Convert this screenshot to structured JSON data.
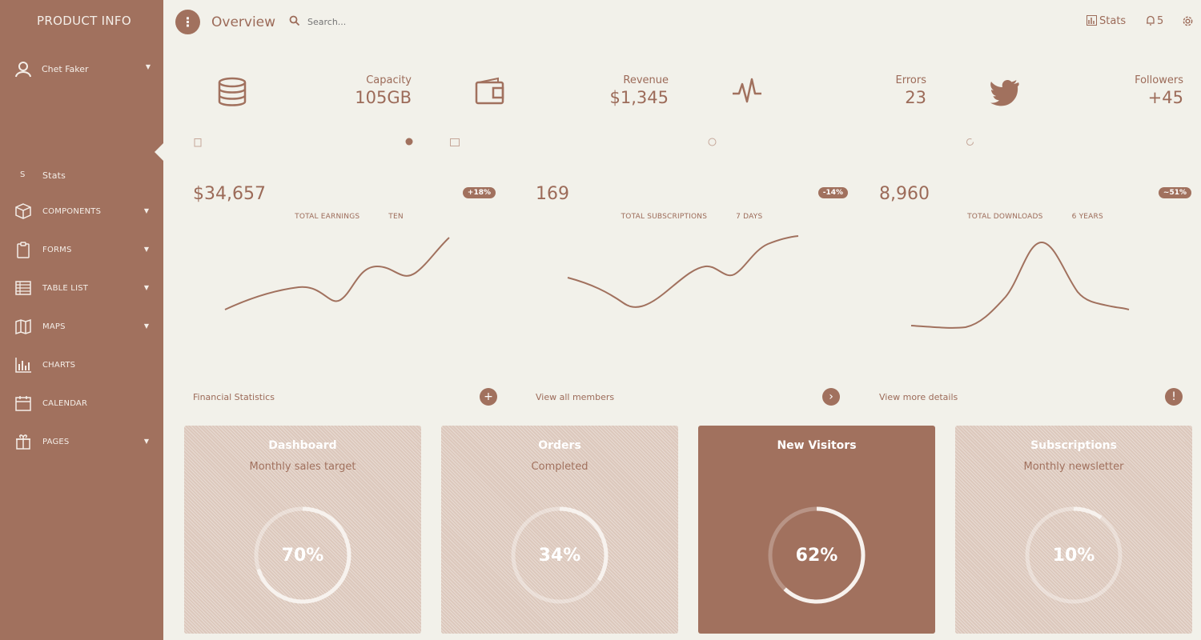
{
  "sidebar": {
    "brand": "PRODUCT INFO",
    "user_name": "Chet Faker",
    "stats_letter": "S",
    "stats_label": "Stats",
    "items": [
      {
        "label": "COMPONENTS",
        "icon": "cube-icon"
      },
      {
        "label": "FORMS",
        "icon": "clipboard-icon"
      },
      {
        "label": "TABLE LIST",
        "icon": "table-list-icon"
      },
      {
        "label": "MAPS",
        "icon": "map-icon"
      },
      {
        "label": "CHARTS",
        "icon": "chart-icon"
      },
      {
        "label": "CALENDAR",
        "icon": "calendar-icon"
      },
      {
        "label": "PAGES",
        "icon": "gift-icon"
      }
    ]
  },
  "topbar": {
    "title": "Overview",
    "search_placeholder": "Search...",
    "stats_label": "Stats",
    "notifications_count": "5"
  },
  "kpis": [
    {
      "label": "Capacity",
      "value": "105GB",
      "icon": "database-icon"
    },
    {
      "label": "Revenue",
      "value": "$1,345",
      "icon": "wallet-icon"
    },
    {
      "label": "Errors",
      "value": "23",
      "icon": "pulse-icon"
    },
    {
      "label": "Followers",
      "value": "+45",
      "icon": "twitter-icon"
    }
  ],
  "charts": [
    {
      "value": "$34,657",
      "badge": "+18%",
      "caption": "TOTAL EARNINGS",
      "period": "TEN"
    },
    {
      "value": "169",
      "badge": "-14%",
      "caption": "TOTAL SUBSCRIPTIONS",
      "period": "7 DAYS"
    },
    {
      "value": "8,960",
      "badge": "~51%",
      "caption": "TOTAL DOWNLOADS",
      "period": "6 YEARS"
    }
  ],
  "footer_links": {
    "financial": "Financial Statistics",
    "members": "View all members",
    "details": "View more details"
  },
  "tiles": [
    {
      "title": "Dashboard",
      "subtitle": "Monthly sales target",
      "percent": "70%",
      "fraction": 0.7
    },
    {
      "title": "Orders",
      "subtitle": "Completed",
      "percent": "34%",
      "fraction": 0.34
    },
    {
      "title": "New Visitors",
      "subtitle": "",
      "percent": "62%",
      "fraction": 0.62
    },
    {
      "title": "Subscriptions",
      "subtitle": "Monthly newsletter",
      "percent": "10%",
      "fraction": 0.1
    }
  ],
  "colors": {
    "accent": "#a1715e",
    "background": "#f2f1ea",
    "tile_light": "#dcc8bc"
  }
}
